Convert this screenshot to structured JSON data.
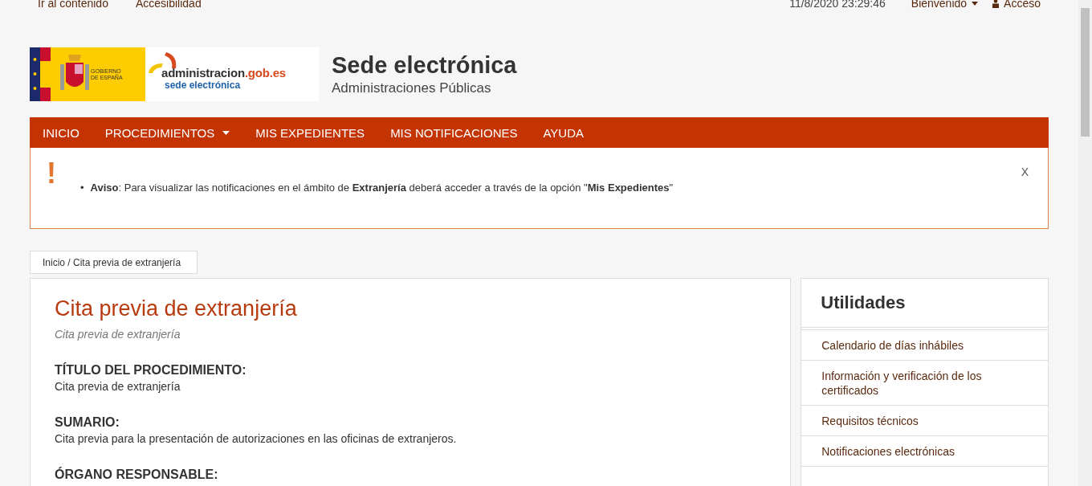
{
  "top_bar": {
    "links": [
      "Ir al contenido",
      "Accesibilidad"
    ],
    "datetime": "11/8/2020 23:29:46",
    "welcome": "Bienvenido",
    "login": "Acceso"
  },
  "header": {
    "gov_logo": "GOBIERNO DE ESPAÑA",
    "admin_logo_domain": "administracion",
    "admin_logo_tld": ".gob.es",
    "admin_logo_sub": "sede electrónica",
    "title": "Sede electrónica",
    "subtitle": "Administraciones Públicas"
  },
  "nav": [
    {
      "label": "INICIO",
      "dropdown": false
    },
    {
      "label": "PROCEDIMIENTOS",
      "dropdown": true
    },
    {
      "label": "MIS EXPEDIENTES",
      "dropdown": false
    },
    {
      "label": "MIS NOTIFICACIONES",
      "dropdown": false
    },
    {
      "label": "AYUDA",
      "dropdown": false
    }
  ],
  "alert": {
    "icon": "!",
    "bullet": "•",
    "text": "**Aviso**: Para visualizar las notificaciones en el ámbito de **Extranjería** deberá acceder a través de la opción \"**Mis Expedientes**\"",
    "close": "X"
  },
  "breadcrumb": "Inicio / Cita previa de extranjería",
  "main": {
    "title": "Cita previa de extranjería",
    "subtitle": "Cita previa de extranjería",
    "sections": [
      {
        "heading": "TÍTULO DEL PROCEDIMIENTO:",
        "text": "Cita previa de extranjería"
      },
      {
        "heading": "SUMARIO:",
        "text": "Cita previa para la presentación de autorizaciones en las oficinas de extranjeros."
      },
      {
        "heading": "ÓRGANO RESPONSABLE:"
      }
    ]
  },
  "sidebar": {
    "title": "Utilidades",
    "items": [
      "Calendario de días inhábiles",
      "Información y verificación de los certificados",
      "Requisitos técnicos",
      "Notificaciones electrónicas"
    ]
  }
}
